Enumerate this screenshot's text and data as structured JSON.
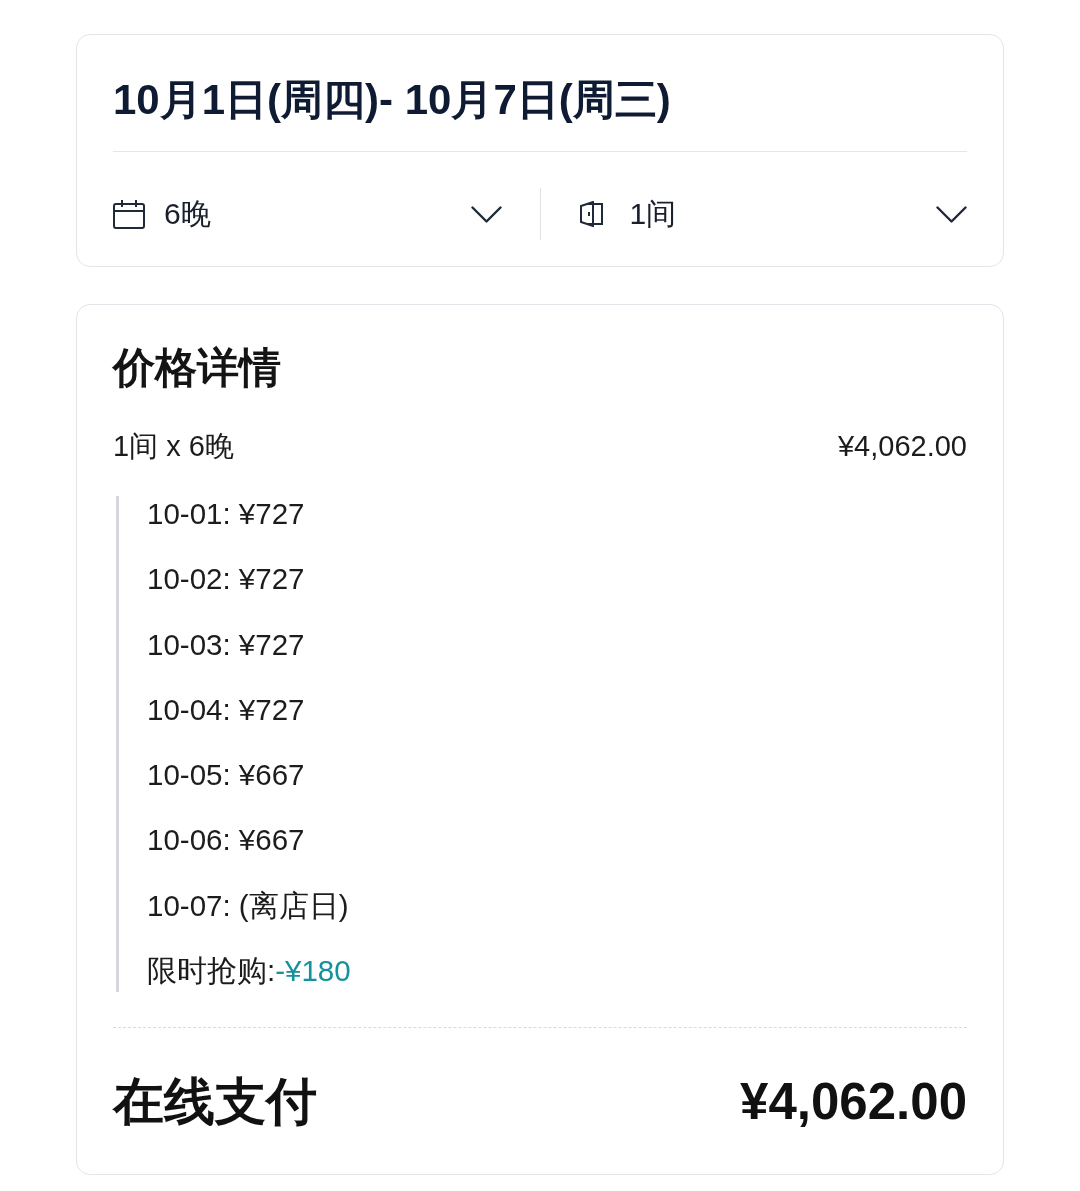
{
  "stay_card": {
    "title": "10月1日(周四)- 10月7日(周三)",
    "selectors": [
      {
        "kind": "nights",
        "value": "6晚"
      },
      {
        "kind": "rooms",
        "value": "1间"
      }
    ]
  },
  "price_card": {
    "title": "价格详情",
    "summary": {
      "label": "1间 x 6晚",
      "amount": "¥4,062.00"
    },
    "nights": [
      "10-01: ¥727",
      "10-02: ¥727",
      "10-03: ¥727",
      "10-04: ¥727",
      "10-05: ¥667",
      "10-06: ¥667",
      "10-07: (离店日)"
    ],
    "discount": {
      "label": "限时抢购:",
      "amount": "-¥180"
    },
    "total": {
      "label": "在线支付",
      "amount": "¥4,062.00"
    }
  }
}
